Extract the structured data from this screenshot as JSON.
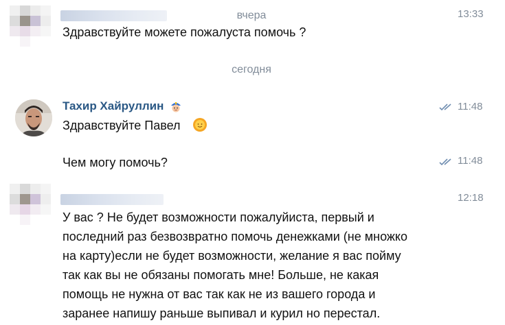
{
  "divider_yesterday": "вчера",
  "divider_today": "сегодня",
  "messages": [
    {
      "time": "13:33",
      "text": "Здравствуйте можете пожалуста помочь ?"
    },
    {
      "sender": "Тахир Хайруллин",
      "time": "11:48",
      "text": "Здравствуйте Павел"
    },
    {
      "time": "11:48",
      "text": "Чем могу помочь?"
    },
    {
      "time": "12:18",
      "lines": [
        "У вас ? Не будет возможности пожалуйиста, первый и",
        "последний раз безвозвратно помочь денежками (не множко",
        "на карту)если не будет возможности, желание я вас пойму",
        "так как вы не обязаны помогать мне! Больше, не какая",
        "помощь не нужна от вас так как не из вашего города и",
        "заранее напишу раньше выпивал и курил но перестал."
      ]
    }
  ],
  "colors": {
    "link_name": "#2a5885",
    "meta_gray": "#818c99",
    "read_check": "#6f8db0"
  },
  "icons": [
    "police-emoji-icon",
    "sun-emoji-icon",
    "double-check-icon"
  ]
}
